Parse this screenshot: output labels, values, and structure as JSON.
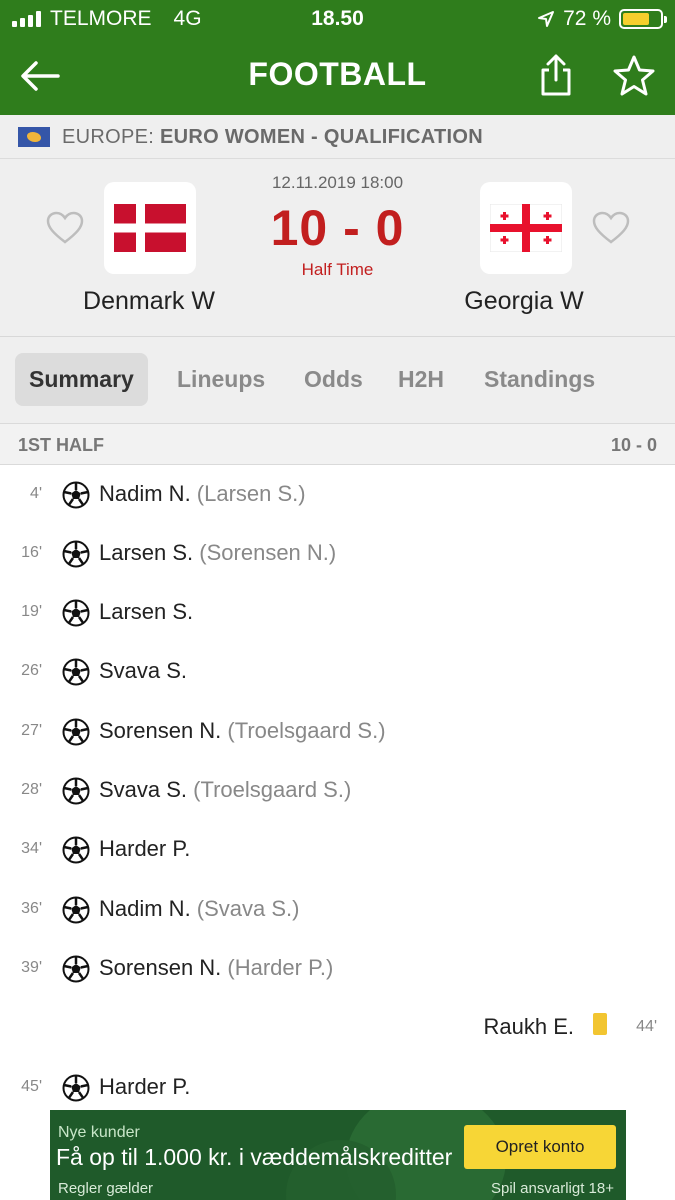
{
  "status_bar": {
    "carrier": "TELMORE",
    "network": "4G",
    "time": "18.50",
    "battery": "72 %",
    "battery_level": 0.72
  },
  "header": {
    "title": "FOOTBALL",
    "back_icon": "back-arrow-icon",
    "share_icon": "share-icon",
    "favorite_icon": "star-icon"
  },
  "league": {
    "region": "EUROPE:",
    "competition": "EURO WOMEN - QUALIFICATION"
  },
  "match": {
    "datetime": "12.11.2019 18:00",
    "score": "10 - 0",
    "status": "Half Time",
    "home": {
      "name": "Denmark W"
    },
    "away": {
      "name": "Georgia W"
    }
  },
  "tabs": [
    {
      "label": "Summary",
      "active": true
    },
    {
      "label": "Lineups"
    },
    {
      "label": "Odds"
    },
    {
      "label": "H2H"
    },
    {
      "label": "Standings"
    }
  ],
  "half": {
    "label": "1ST HALF",
    "score": "10 - 0"
  },
  "events": [
    {
      "minute": "4'",
      "player": "Nadim N.",
      "assist": "(Larsen S.)",
      "side": "home",
      "type": "goal"
    },
    {
      "minute": "16'",
      "player": "Larsen S.",
      "assist": "(Sorensen N.)",
      "side": "home",
      "type": "goal"
    },
    {
      "minute": "19'",
      "player": "Larsen S.",
      "assist": "",
      "side": "home",
      "type": "goal"
    },
    {
      "minute": "26'",
      "player": "Svava S.",
      "assist": "",
      "side": "home",
      "type": "goal"
    },
    {
      "minute": "27'",
      "player": "Sorensen N.",
      "assist": "(Troelsgaard S.)",
      "side": "home",
      "type": "goal"
    },
    {
      "minute": "28'",
      "player": "Svava S.",
      "assist": "(Troelsgaard S.)",
      "side": "home",
      "type": "goal"
    },
    {
      "minute": "34'",
      "player": "Harder P.",
      "assist": "",
      "side": "home",
      "type": "goal"
    },
    {
      "minute": "36'",
      "player": "Nadim N.",
      "assist": "(Svava S.)",
      "side": "home",
      "type": "goal"
    },
    {
      "minute": "39'",
      "player": "Sorensen N.",
      "assist": "(Harder P.)",
      "side": "home",
      "type": "goal"
    },
    {
      "minute": "44'",
      "player": "Raukh E.",
      "assist": "",
      "side": "away",
      "type": "yellow-card"
    },
    {
      "minute": "45'",
      "player": "Harder P.",
      "assist": "",
      "side": "home",
      "type": "goal"
    }
  ],
  "ad": {
    "small": "Nye kunder",
    "headline": "Få op til 1.000 kr. i væddemålskreditter",
    "cta": "Opret konto",
    "rules": "Regler gælder",
    "responsible": "Spil ansvarligt  18+"
  },
  "colors": {
    "brand_green": "#2f7d1c",
    "score_red": "#c21f1f",
    "yellow_card": "#f2c531"
  }
}
